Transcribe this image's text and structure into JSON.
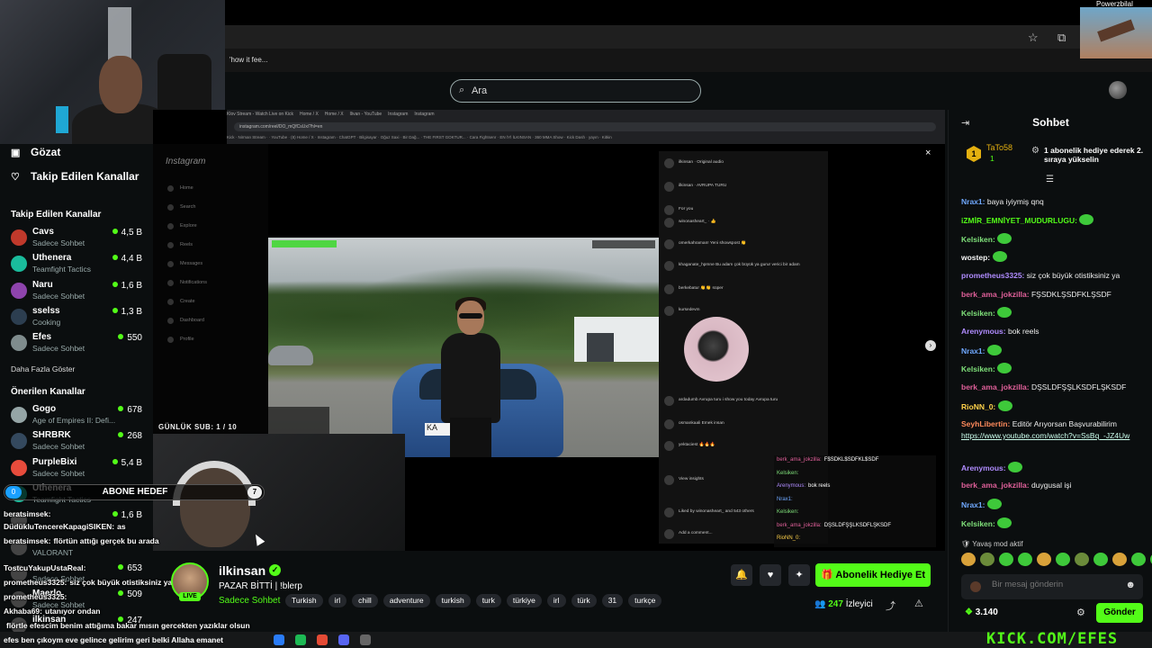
{
  "browser": {
    "bookmark_text": "'how it fee..."
  },
  "corner_thumb": {
    "name": "Powerzbilal"
  },
  "search": {
    "placeholder": "Ara"
  },
  "sidebar": {
    "main": [
      {
        "label": "Gözat",
        "icon": "compass-icon"
      },
      {
        "label": "Takip Edilen Kanallar",
        "icon": "heart-icon"
      }
    ],
    "followed_title": "Takip Edilen Kanallar",
    "followed": [
      {
        "name": "Cavs",
        "game": "Sadece Sohbet",
        "viewers": "4,5 B",
        "color": "#c0392b"
      },
      {
        "name": "Uthenera",
        "game": "Teamfight Tactics",
        "viewers": "4,4 B",
        "color": "#1abc9c"
      },
      {
        "name": "Naru",
        "game": "Sadece Sohbet",
        "viewers": "1,6 B",
        "color": "#8e44ad"
      },
      {
        "name": "sselss",
        "game": "Cooking",
        "viewers": "1,3 B",
        "color": "#2c3e50"
      },
      {
        "name": "Efes",
        "game": "Sadece Sohbet",
        "viewers": "550",
        "color": "#7f8c8d"
      }
    ],
    "show_more": "Daha Fazla Göster",
    "recommended_title": "Önerilen Kanallar",
    "recommended": [
      {
        "name": "Gogo",
        "game": "Age of Empires II: Defi...",
        "viewers": "678",
        "color": "#95a5a6"
      },
      {
        "name": "SHRBRK",
        "game": "Sadece Sohbet",
        "viewers": "268",
        "color": "#34495e"
      },
      {
        "name": "PurpleBixi",
        "game": "Sadece Sohbet",
        "viewers": "5,4 B",
        "color": "#e74c3c"
      },
      {
        "name": "Uthenera",
        "game": "Teamfight Tactics",
        "viewers": "",
        "color": "#1abc9c"
      },
      {
        "name": "",
        "game": "",
        "viewers": "1,6 B",
        "color": "#444"
      },
      {
        "name": "",
        "game": "VALORANT",
        "viewers": "",
        "color": "#444"
      },
      {
        "name": "",
        "game": "Sadece Sohbet",
        "viewers": "653",
        "color": "#444"
      },
      {
        "name": "Maerlo",
        "game": "Sadece Sohbet",
        "viewers": "509",
        "color": "#444"
      },
      {
        "name": "ilkinsan",
        "game": "",
        "viewers": "247",
        "color": "#444"
      }
    ]
  },
  "video": {
    "sub_counter": "GÜNLÜK SUB: 1 / 10",
    "close": "×",
    "next": "›",
    "ig_logo": "Instagram",
    "ig_nav": [
      "Home",
      "Search",
      "Explore",
      "Reels",
      "Messages",
      "Notifications",
      "Create",
      "Dashboard",
      "Profile"
    ],
    "ig_rows": [
      "ilkinsan · Original audio",
      "ilkinsan · AVRUPA TURU",
      "For you",
      "winonasheart_ · 👍",
      "omerkahraman! Yeni showspost 👏",
      "khaganate_hpmne Bu adam çok büyük ya gurur verici bir adam",
      "berkebatur 👏👏 süper",
      "kursedevm",
      "ardadumb Avrupa turu i show you today Avrupa turu",
      "osmankaali Emek insan",
      "yektaciest 🔥🔥🔥",
      "View insights",
      "Liked by winonasheart_ and 543 others",
      "Add a comment..."
    ],
    "overlay_chat": [
      {
        "user": "berk_ama_jokzilla:",
        "text": "F$SDKL$SDFKL$SDF",
        "color": "#e0609a"
      },
      {
        "user": "Kelsiken:",
        "text": "",
        "color": "#7fe07a"
      },
      {
        "user": "Arenymous:",
        "text": "bok reels",
        "color": "#b08cff"
      },
      {
        "user": "Nrax1:",
        "text": "",
        "color": "#6fa8ff"
      },
      {
        "user": "Kelsiken:",
        "text": "",
        "color": "#7fe07a"
      },
      {
        "user": "berk_ama_jokzilla:",
        "text": "DŞSLDFŞŞLKSDFLŞKSDF",
        "color": "#e0609a"
      },
      {
        "user": "RioNN_0:",
        "text": "",
        "color": "#ffd24a"
      }
    ]
  },
  "sub_goal": {
    "current": "0",
    "label": "ABONE HEDEF",
    "target": "7"
  },
  "overlay_chat_left": [
    {
      "user": "beratsimsek:",
      "text": ""
    },
    {
      "user": "DüdükluTencereKapagiSIKEN:",
      "text": "as"
    },
    {
      "user": "beratsimsek:",
      "text": "flörtün attığı gerçek bu arada"
    },
    {
      "user": "TostcuYakupUstaReal:",
      "text": ""
    },
    {
      "user": "prometheus3325:",
      "text": "siz çok büyük otistiksiniz ya"
    },
    {
      "user": "prometheus3325:",
      "text": ""
    },
    {
      "user": "Akhaba69:",
      "text": "utanıyor ondan"
    },
    {
      "user": "",
      "text": "flörtle efescim benim attığıma bakar mısın gercekten yazıklar olsun"
    }
  ],
  "ticker": "efes ben çıkoym eve gelince gelirim geri belki Allaha emanet",
  "stream": {
    "name": "ilkinsan",
    "title": "PAZAR BİTTİ | !blerp",
    "category": "Sadece Sohbet",
    "tags": [
      "Turkish",
      "irl",
      "chill",
      "adventure",
      "turkish",
      "turk",
      "türkiye",
      "irl",
      "türk",
      "31",
      "turkçe"
    ],
    "live": "LIVE",
    "subscribe_gift": "Abonelik Hediye Et",
    "viewers_count": "247",
    "viewers_label": "İzleyici"
  },
  "chat": {
    "title": "Sohbet",
    "pinned": {
      "user": "TaTo58",
      "count": "1",
      "message": "1 abonelik hediye ederek 2. sıraya yükselin"
    },
    "messages": [
      {
        "user": "Nrax1:",
        "text": "baya iyiymiş qnq",
        "color": "#6fa8ff",
        "emote": false
      },
      {
        "user": "iZMİR_EMNİYET_MUDURLUGU:",
        "text": "",
        "color": "#53fc18",
        "emote": true
      },
      {
        "user": "Kelsiken:",
        "text": "",
        "color": "#7fe07a",
        "emote": true
      },
      {
        "user": "wostep:",
        "text": "",
        "color": "#f5f5f5",
        "emote": true
      },
      {
        "user": "prometheus3325:",
        "text": "siz çok büyük otistiksiniz ya",
        "color": "#b08cff",
        "emote": false
      },
      {
        "user": "berk_ama_jokzilla:",
        "text": "FŞSDKLŞSDFKLŞSDF",
        "color": "#e0609a",
        "emote": false
      },
      {
        "user": "Kelsiken:",
        "text": "",
        "color": "#7fe07a",
        "emote": true
      },
      {
        "user": "Arenymous:",
        "text": "bok reels",
        "color": "#b08cff",
        "emote": false
      },
      {
        "user": "Nrax1:",
        "text": "",
        "color": "#6fa8ff",
        "emote": true
      },
      {
        "user": "Kelsiken:",
        "text": "",
        "color": "#7fe07a",
        "emote": true
      },
      {
        "user": "berk_ama_jokzilla:",
        "text": "DŞSLDFŞŞLKSDFLŞKSDF",
        "color": "#e0609a",
        "emote": false
      },
      {
        "user": "RioNN_0:",
        "text": "",
        "color": "#ffd24a",
        "emote": true
      },
      {
        "user": "SeyhLibertin:",
        "text": "Editör Arıyorsan Başvurabilirim",
        "color": "#ff8a5c",
        "emote": false
      },
      {
        "user": "",
        "text": "https://www.youtube.com/watch?v=SsBq_-JZ4Uw",
        "color": "#cfe",
        "emote": false
      },
      {
        "user": "Arenymous:",
        "text": "",
        "color": "#b08cff",
        "emote": true
      },
      {
        "user": "berk_ama_jokzilla:",
        "text": "duygusal işi",
        "color": "#e0609a",
        "emote": false
      },
      {
        "user": "Nrax1:",
        "text": "",
        "color": "#6fa8ff",
        "emote": true
      },
      {
        "user": "Kelsiken:",
        "text": "",
        "color": "#7fe07a",
        "emote": true
      }
    ],
    "slow_mode": "Yavaş mod aktif",
    "input_placeholder": "Bir mesaj gönderin",
    "points": "3.140",
    "send": "Gönder"
  },
  "brand": "KICK.COM/EFES"
}
